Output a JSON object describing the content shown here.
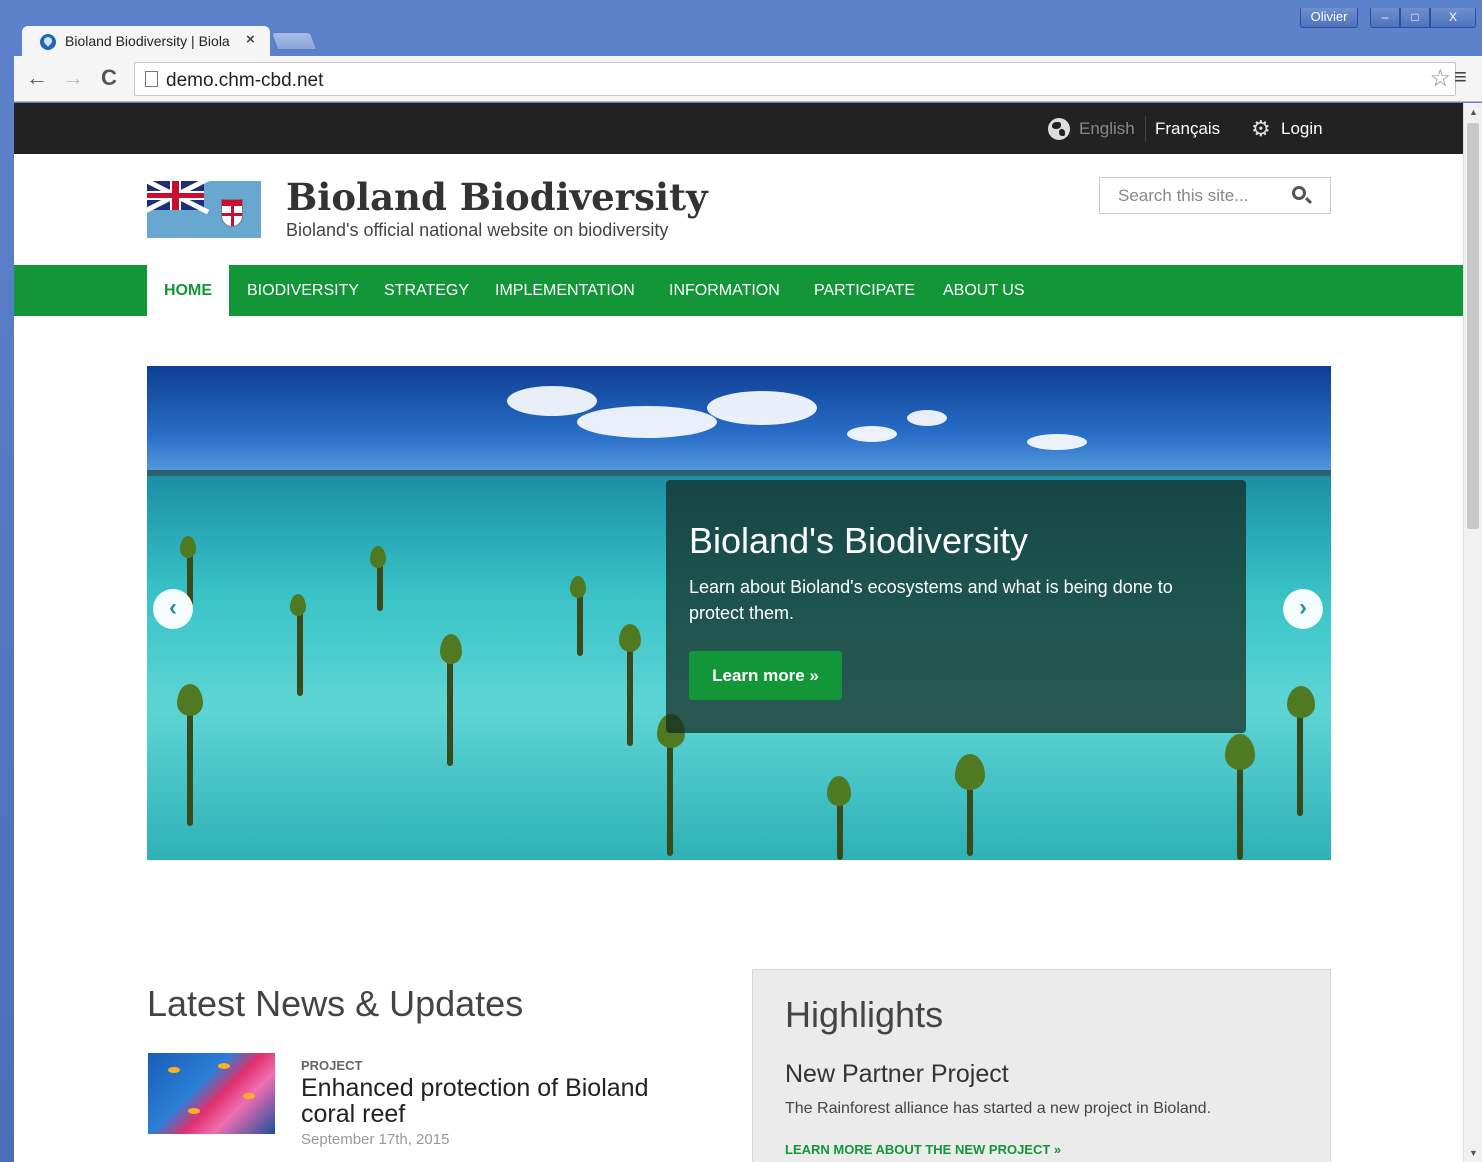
{
  "browser": {
    "tab_title": "Bioland Biodiversity | Biola",
    "tab_close": "×",
    "url": "demo.chm-cbd.net",
    "user": "Olivier",
    "btn_min": "–",
    "btn_max": "□",
    "btn_close": "X",
    "back": "←",
    "forward": "→",
    "reload": "C",
    "star": "☆",
    "menu": "≡"
  },
  "topbar": {
    "lang_en": "English",
    "lang_fr": "Français",
    "login": "Login",
    "gear": "⚙"
  },
  "header": {
    "title": "Bioland Biodiversity",
    "subtitle": "Bioland's official national website on biodiversity",
    "search_placeholder": "Search this site..."
  },
  "nav": {
    "items": [
      "HOME",
      "BIODIVERSITY",
      "STRATEGY",
      "IMPLEMENTATION",
      "INFORMATION",
      "PARTICIPATE",
      "ABOUT US"
    ],
    "active": "HOME"
  },
  "slider": {
    "heading": "Bioland's Biodiversity",
    "text": "Learn about Bioland's ecosystems and what is being done to protect them.",
    "button": "Learn more »",
    "prev": "‹",
    "next": "›"
  },
  "news": {
    "title": "Latest News & Updates",
    "items": [
      {
        "category": "PROJECT",
        "headline": "Enhanced protection of Bioland coral reef",
        "date": "September 17th, 2015"
      }
    ]
  },
  "highlights": {
    "title": "Highlights",
    "subtitle": "New Partner Project",
    "text": "The Rainforest alliance has started a new project in Bioland.",
    "link": "LEARN MORE ABOUT THE NEW PROJECT »"
  },
  "colors": {
    "brand_green": "#139638",
    "topbar": "#222222",
    "chrome_frame": "#4a6fb5"
  }
}
